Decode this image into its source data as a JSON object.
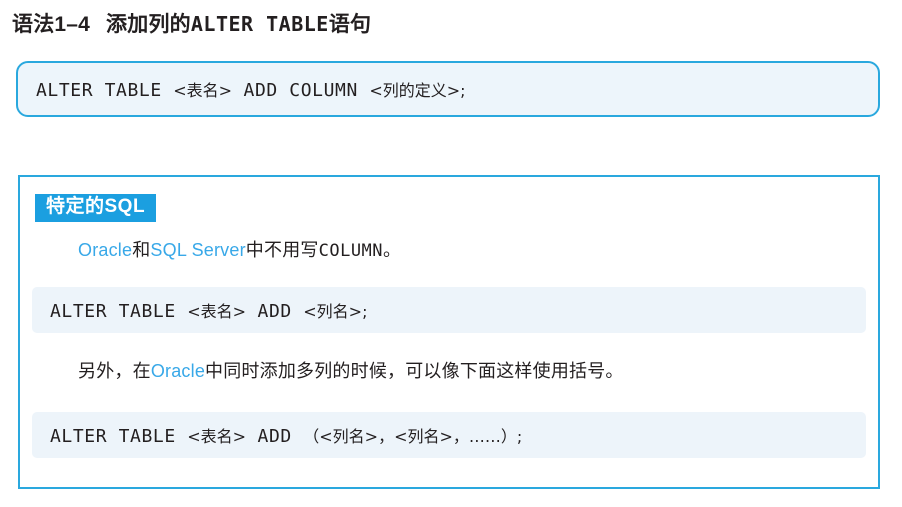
{
  "title": {
    "prefix": "语法1–4",
    "body_before_mono": "添加列的",
    "mono": "ALTER TABLE",
    "body_after_mono": "语句"
  },
  "syntax_box": {
    "code_prefix": "ALTER TABLE ",
    "code_arg1": "<表名>",
    "code_middle": " ADD COLUMN ",
    "code_arg2": "<列的定义>",
    "code_suffix": ";"
  },
  "panel": {
    "badge": "特定的SQL",
    "paragraph_1": {
      "db1": "Oracle",
      "join": "和",
      "db2": "SQL Server",
      "text_mid": "中不用写",
      "keyword": "COLUMN",
      "text_end": "。"
    },
    "code_block_1": {
      "code_prefix": "ALTER TABLE ",
      "code_arg1": "<表名>",
      "code_middle": " ADD ",
      "code_arg2": "<列名>",
      "code_suffix": ";"
    },
    "paragraph_2": {
      "text_start": "另外，在",
      "db1": "Oracle",
      "text_end": "中同时添加多列的时候，可以像下面这样使用括号。"
    },
    "code_block_2": {
      "code_prefix": "ALTER TABLE ",
      "code_arg1": "<表名>",
      "code_middle": " ADD ",
      "code_args": "（<列名>，<列名>，……）",
      "code_suffix": ";"
    }
  },
  "colors": {
    "border_blue": "#2aa8de",
    "badge_blue": "#1b9fe0",
    "code_bg": "#edf4fa",
    "syntax_bg": "#edf5fb",
    "link_blue": "#38a8e8",
    "text": "#231f20"
  }
}
